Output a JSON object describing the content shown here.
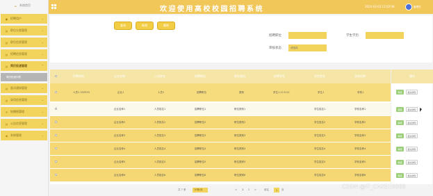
{
  "header": {
    "title": "欢迎使用高校校园招聘系统",
    "datetime": "2024-03-03 12:02:08",
    "username": "管理员"
  },
  "sidebar": {
    "home": "系统首页",
    "items": [
      {
        "label": "招聘用户",
        "icon": "user-icon"
      },
      {
        "label": "职位分类管理",
        "icon": "doc-icon"
      },
      {
        "label": "职位信息管理",
        "icon": "doc-icon"
      },
      {
        "label": "招聘信息管理",
        "icon": "doc-icon"
      },
      {
        "label": "简历投递管理",
        "icon": "doc-icon",
        "active": true,
        "sub": "简历投递列表"
      },
      {
        "label": "面试通知管理",
        "icon": "doc-icon"
      },
      {
        "label": "录用信息管理",
        "icon": "doc-icon"
      },
      {
        "label": "轮播图管理",
        "icon": "gear-icon"
      },
      {
        "label": "公告信息管理",
        "icon": "doc-icon"
      },
      {
        "label": "系统管理",
        "icon": "settings-icon"
      }
    ]
  },
  "search": {
    "buttons": {
      "search": "查询",
      "add": "新增",
      "delete": "删除"
    },
    "fields": [
      {
        "label": "招聘职位",
        "value": "",
        "placeholder": ""
      },
      {
        "label": "学生学历",
        "value": "",
        "placeholder": ""
      },
      {
        "label": "审核状态",
        "value": "",
        "placeholder": "请选择"
      }
    ]
  },
  "table": {
    "columns": [
      "招聘学校",
      "企业名称",
      "人员姓名",
      "招聘职位",
      "职位类别",
      "招聘学生",
      "学生姓名",
      "学校名称",
      "操作"
    ],
    "rows": [
      [
        "人员1-333333",
        "企业1",
        "人员1",
        "招聘职位",
        "类别",
        "学生1-111111",
        "学生1",
        "学校1"
      ],
      [
        "",
        "企业名称1",
        "人员姓名1",
        "招聘职位1",
        "职位类别1",
        "",
        "学生姓名1",
        "学校名称1"
      ],
      [
        "",
        "企业名称2",
        "人员姓名2",
        "招聘职位2",
        "职位类别2",
        "",
        "学生姓名2",
        "学校名称2"
      ],
      [
        "",
        "企业名称3",
        "人员姓名3",
        "招聘职位3",
        "职位类别3",
        "",
        "学生姓名3",
        "学校名称3"
      ],
      [
        "",
        "企业名称4",
        "人员姓名4",
        "招聘职位4",
        "职位类别4",
        "",
        "学生姓名4",
        "学校名称4"
      ],
      [
        "",
        "企业名称5",
        "人员姓名5",
        "招聘职位5",
        "职位类别5",
        "",
        "学生姓名5",
        "学校名称5"
      ],
      [
        "",
        "企业名称6",
        "人员姓名6",
        "招聘职位6",
        "职位类别6",
        "",
        "学生姓名6",
        "学校名称6"
      ]
    ],
    "op_buttons": {
      "audit": "审核",
      "notice": "面试通知"
    }
  },
  "pager": {
    "total": "共 7 条",
    "page_size": "10条/页",
    "prev": "<",
    "page1": "1",
    "page2": "2",
    "next": ">",
    "goto": "前往",
    "current": "1",
    "page_unit": "页"
  },
  "watermark": "CSDN @IT_CAKE10088",
  "colors": {
    "accent": "#f2d45c",
    "header": "#f1c75a"
  }
}
